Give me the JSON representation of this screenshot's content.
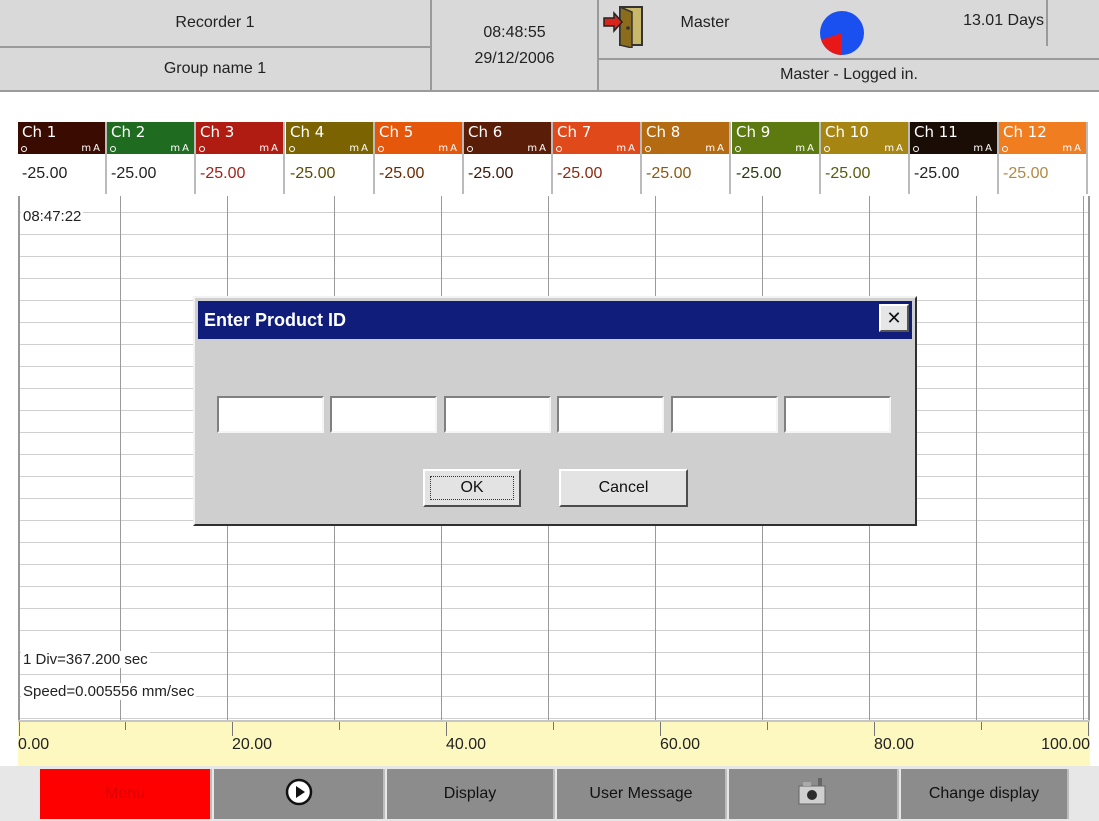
{
  "header": {
    "recorder_name": "Recorder 1",
    "group_name": "Group name 1",
    "time": "08:48:55",
    "date": "29/12/2006",
    "user": "Master",
    "status": "Master - Logged in.",
    "days_remaining": "13.01 Days",
    "icons": [
      "door-exit-icon",
      "disk-usage-pie-icon"
    ],
    "pie_used_fraction": 0.2
  },
  "channels": [
    {
      "name": "Ch 1",
      "unit": "mA",
      "value": "-25.00",
      "color": "#3a0b00",
      "value_color": "#222222"
    },
    {
      "name": "Ch 2",
      "unit": "mA",
      "value": "-25.00",
      "color": "#1f6b1f",
      "value_color": "#222222"
    },
    {
      "name": "Ch 3",
      "unit": "mA",
      "value": "-25.00",
      "color": "#b01c12",
      "value_color": "#a3221a"
    },
    {
      "name": "Ch 4",
      "unit": "mA",
      "value": "-25.00",
      "color": "#7a6300",
      "value_color": "#5c4b00"
    },
    {
      "name": "Ch 5",
      "unit": "mA",
      "value": "-25.00",
      "color": "#e5570a",
      "value_color": "#6a2a00"
    },
    {
      "name": "Ch 6",
      "unit": "mA",
      "value": "-25.00",
      "color": "#5a1d08",
      "value_color": "#3a1a0a"
    },
    {
      "name": "Ch 7",
      "unit": "mA",
      "value": "-25.00",
      "color": "#e0491a",
      "value_color": "#8a2a10"
    },
    {
      "name": "Ch 8",
      "unit": "mA",
      "value": "-25.00",
      "color": "#b36a10",
      "value_color": "#8a5a10"
    },
    {
      "name": "Ch 9",
      "unit": "mA",
      "value": "-25.00",
      "color": "#5c7a10",
      "value_color": "#2a3a10"
    },
    {
      "name": "Ch 10",
      "unit": "mA",
      "value": "-25.00",
      "color": "#a68512",
      "value_color": "#5a5a10"
    },
    {
      "name": "Ch 11",
      "unit": "mA",
      "value": "-25.00",
      "color": "#1a0d05",
      "value_color": "#222222"
    },
    {
      "name": "Ch 12",
      "unit": "mA",
      "value": "-25.00",
      "color": "#f07d20",
      "value_color": "#b08a40"
    }
  ],
  "chart": {
    "start_time": "08:47:22",
    "division": "1 Div=367.200 sec",
    "speed": "Speed=0.005556 mm/sec"
  },
  "scale": {
    "min": 0,
    "max": 100,
    "labels": [
      "0.00",
      "20.00",
      "40.00",
      "60.00",
      "80.00",
      "100.00"
    ]
  },
  "toolbar": {
    "menu_label": "Menu",
    "display_label": "Display",
    "user_message_label": "User Message",
    "change_display_label": "Change display",
    "menu_color": "#ff0000"
  },
  "dialog": {
    "title": "Enter Product ID",
    "close_glyph": "✕",
    "field_values": [
      "",
      "",
      "",
      "",
      "",
      ""
    ],
    "ok_label": "OK",
    "cancel_label": "Cancel"
  }
}
